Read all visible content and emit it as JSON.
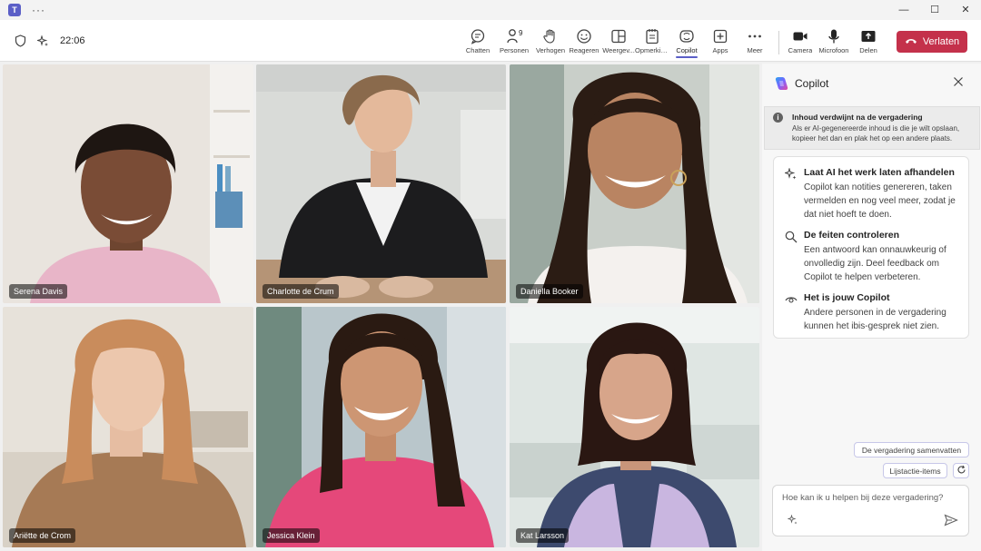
{
  "window": {
    "more_label": "···",
    "minimize": "—",
    "maximize": "☐",
    "close": "✕"
  },
  "header": {
    "time": "22:06"
  },
  "toolbar": {
    "buttons": [
      {
        "label": "Chatten",
        "icon": "chat-icon"
      },
      {
        "label": "Personen",
        "icon": "people-icon",
        "badge": "9"
      },
      {
        "label": "Verhogen",
        "icon": "raise-hand-icon"
      },
      {
        "label": "Reageren",
        "icon": "emoji-icon"
      },
      {
        "label": "Weergev...",
        "icon": "view-icon"
      },
      {
        "label": "Opmerkin...",
        "icon": "notes-icon"
      },
      {
        "label": "Copilot",
        "icon": "copilot-icon",
        "active": true
      },
      {
        "label": "Apps",
        "icon": "apps-icon"
      },
      {
        "label": "Meer",
        "icon": "more-icon"
      },
      {
        "label": "Camera",
        "icon": "camera-icon"
      },
      {
        "label": "Microfoon",
        "icon": "microphone-icon"
      },
      {
        "label": "Delen",
        "icon": "share-icon"
      }
    ],
    "leave_label": "Verlaten",
    "leave_color": "#c4314b"
  },
  "participants": [
    {
      "name": "Serena Davis"
    },
    {
      "name": "Charlotte de Crum"
    },
    {
      "name": "Daniella Booker"
    },
    {
      "name": "Ariëtte de Crom"
    },
    {
      "name": "Jessica Klein"
    },
    {
      "name": "Kat Larsson"
    }
  ],
  "copilot": {
    "title": "Copilot",
    "notice_title": "Inhoud verdwijnt na de vergadering",
    "notice_body": "Als er AI-gegenereerde inhoud is die je wilt opslaan, kopieer het dan en plak het op een andere plaats.",
    "items": [
      {
        "title": "Laat AI het werk laten afhandelen",
        "body": "Copilot kan notities genereren, taken vermelden en nog veel meer, zodat je dat niet hoeft te doen."
      },
      {
        "title": "De feiten controleren",
        "body": "Een antwoord kan onnauwkeurig of onvolledig zijn. Deel feedback om Copilot te helpen verbeteren."
      },
      {
        "title": "Het is jouw Copilot",
        "body": "Andere personen in de vergadering kunnen het ibis-gesprek niet zien."
      }
    ],
    "chips": [
      "De vergadering samenvatten",
      "Lijstactie-items"
    ],
    "input_placeholder": "Hoe kan ik u helpen bij deze vergadering?",
    "accent": "#5b5fc7"
  }
}
